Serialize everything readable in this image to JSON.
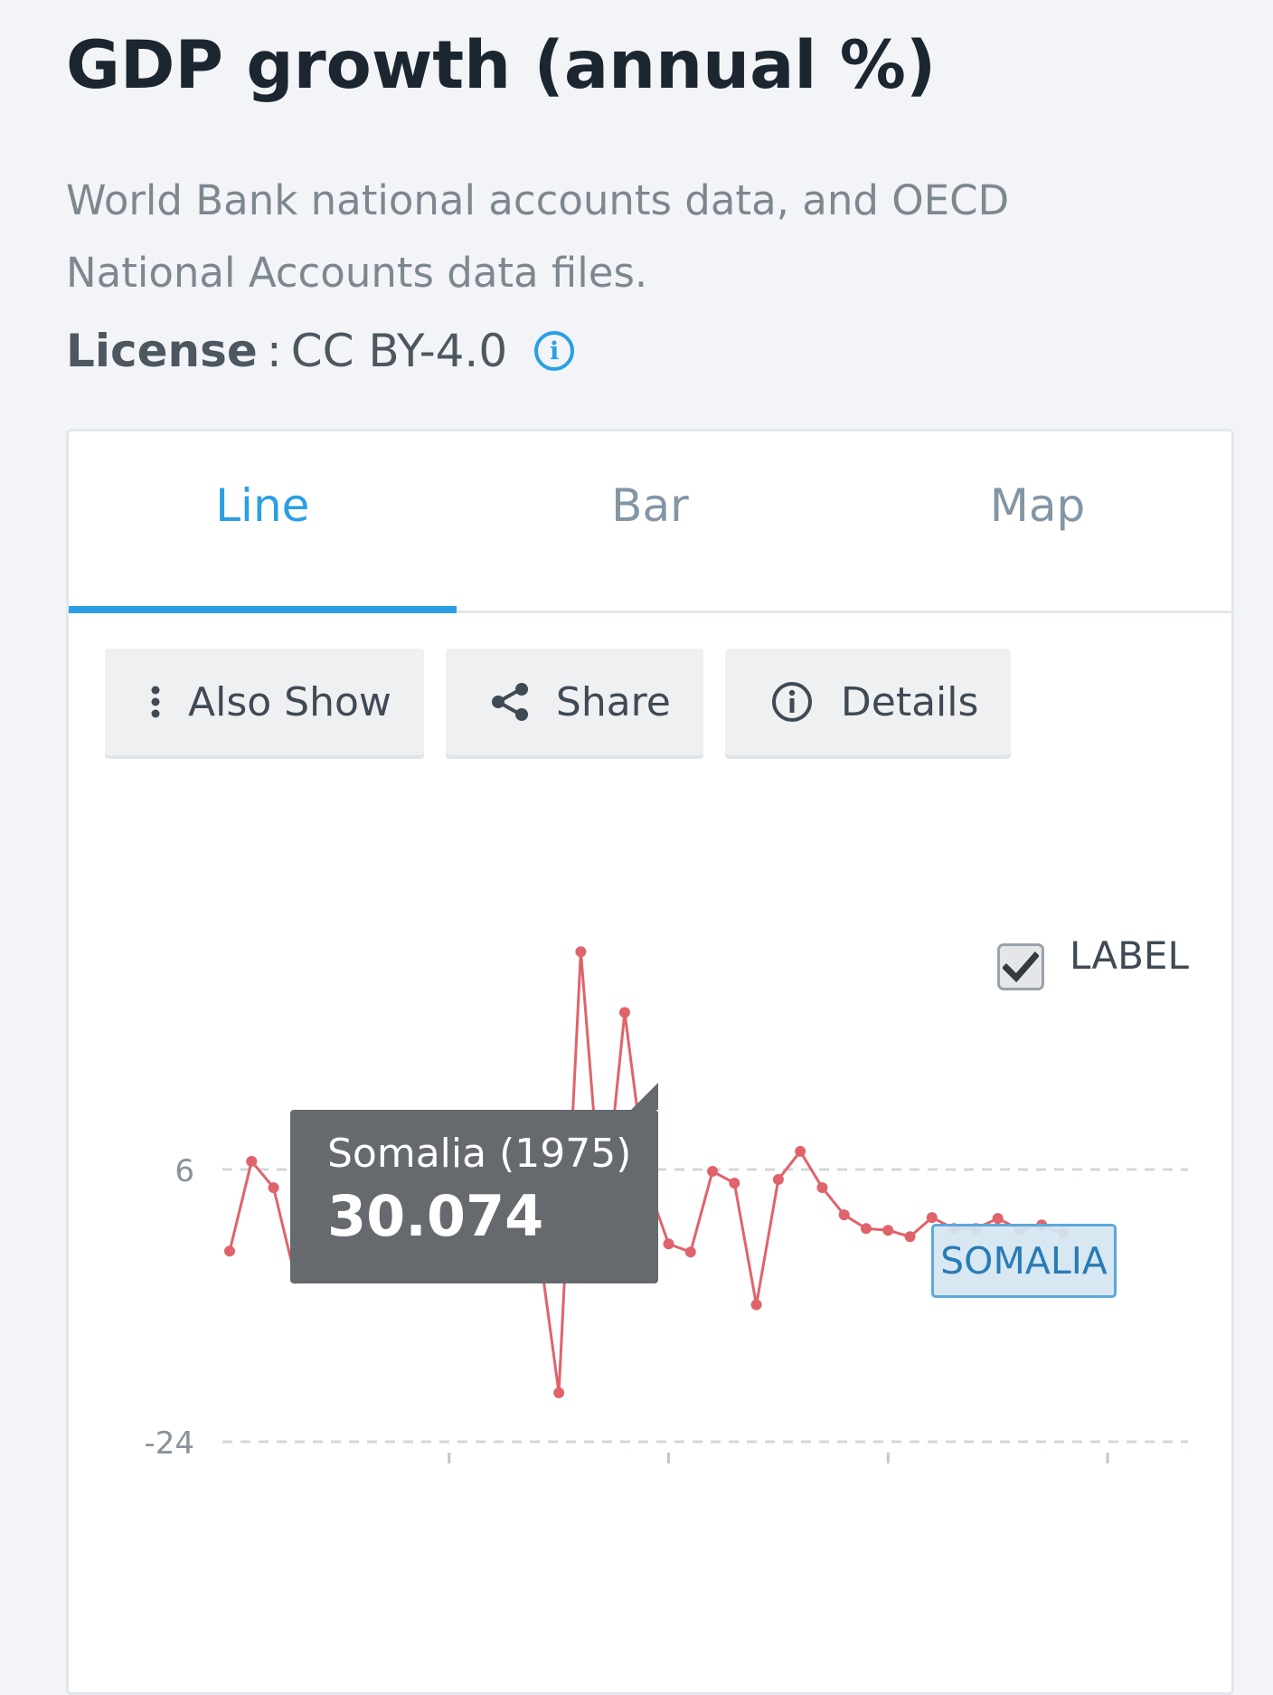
{
  "page": {
    "title": "GDP growth (annual %)",
    "source": "World Bank national accounts data, and OECD National Accounts data files.",
    "license_label": "License",
    "license_sep": ":",
    "license_value": "CC BY-4.0"
  },
  "tabs": [
    {
      "label": "Line",
      "active": true
    },
    {
      "label": "Bar",
      "active": false
    },
    {
      "label": "Map",
      "active": false
    }
  ],
  "toolbar": {
    "also_show": "Also Show",
    "share": "Share",
    "details": "Details"
  },
  "label_toggle": {
    "text": "LABEL",
    "checked": true
  },
  "tooltip": {
    "title": "Somalia (1975)",
    "value": "30.074"
  },
  "series_label": "SOMALIA",
  "colors": {
    "accent": "#2b9fe3",
    "series": "#e0636b",
    "tooltip_bg": "#666a6f"
  },
  "chart_data": {
    "type": "line",
    "series": [
      {
        "name": "SOMALIA",
        "x": [
          1961,
          1962,
          1963,
          1964,
          1965,
          1966,
          1967,
          1968,
          1969,
          1970,
          1971,
          1972,
          1973,
          1974,
          1975,
          1976,
          1977,
          1978,
          1979,
          1980,
          1981,
          1982,
          1983,
          1984,
          1985,
          1986,
          1987,
          1988,
          1989,
          1990,
          1991,
          1992,
          1993,
          1994,
          1995,
          1996,
          1997,
          1998,
          1999
        ],
        "y": [
          -3.0,
          6.9,
          4.0,
          -6.0,
          -5.9,
          5.8,
          5.9,
          6.1,
          6.0,
          3.5,
          -0.4,
          3.9,
          2.6,
          6.9,
          -0.8,
          -18.6,
          30.0,
          -0.2,
          23.3,
          4.6,
          -2.2,
          -3.1,
          5.8,
          4.5,
          -8.9,
          4.9,
          8.0,
          4.0,
          1.0,
          -0.5,
          -0.7,
          -1.4,
          0.7,
          -0.5,
          -0.5,
          0.6,
          -0.6,
          -0.1,
          -1.0
        ],
        "color": "#e0636b"
      }
    ],
    "y_ticks": [
      -24,
      6,
      36
    ],
    "ylim": [
      -24,
      36
    ],
    "xlim": [
      1961,
      2001
    ],
    "x_tick_marks": [
      1971,
      1981,
      1991,
      2001
    ],
    "grid": true
  }
}
